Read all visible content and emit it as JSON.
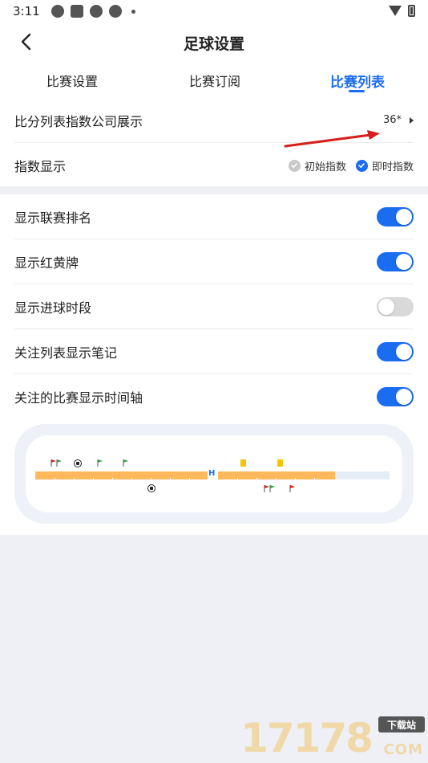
{
  "status_bar": {
    "time": "3:11",
    "icons": [
      "app-icon",
      "app-icon",
      "app-icon",
      "app-icon"
    ]
  },
  "header": {
    "title": "足球设置",
    "back_icon": "chevron-left-icon"
  },
  "tabs": [
    {
      "label": "比赛设置",
      "active": false
    },
    {
      "label": "比赛订阅",
      "active": false
    },
    {
      "label": "比赛列表",
      "active": true
    }
  ],
  "section1": {
    "company_display": {
      "label": "比分列表指数公司展示",
      "value": "36*"
    },
    "index_display": {
      "label": "指数显示",
      "options": [
        {
          "label": "初始指数",
          "checked": false
        },
        {
          "label": "即时指数",
          "checked": true
        }
      ]
    }
  },
  "section2": {
    "toggles": [
      {
        "label": "显示联赛排名",
        "on": true
      },
      {
        "label": "显示红黄牌",
        "on": true
      },
      {
        "label": "显示进球时段",
        "on": false
      },
      {
        "label": "关注列表显示笔记",
        "on": true
      },
      {
        "label": "关注的比赛显示时间轴",
        "on": true
      }
    ]
  },
  "timeline_preview": {
    "half_marker": "H"
  },
  "watermark": {
    "logo_text": "17178",
    "badge": "下载站",
    "domain": "COM"
  },
  "colors": {
    "accent": "#1a6cf0",
    "timeline_bar": "#ffb95c",
    "toggle_off": "#d9d9d9",
    "annotation_arrow": "#d6201e"
  }
}
